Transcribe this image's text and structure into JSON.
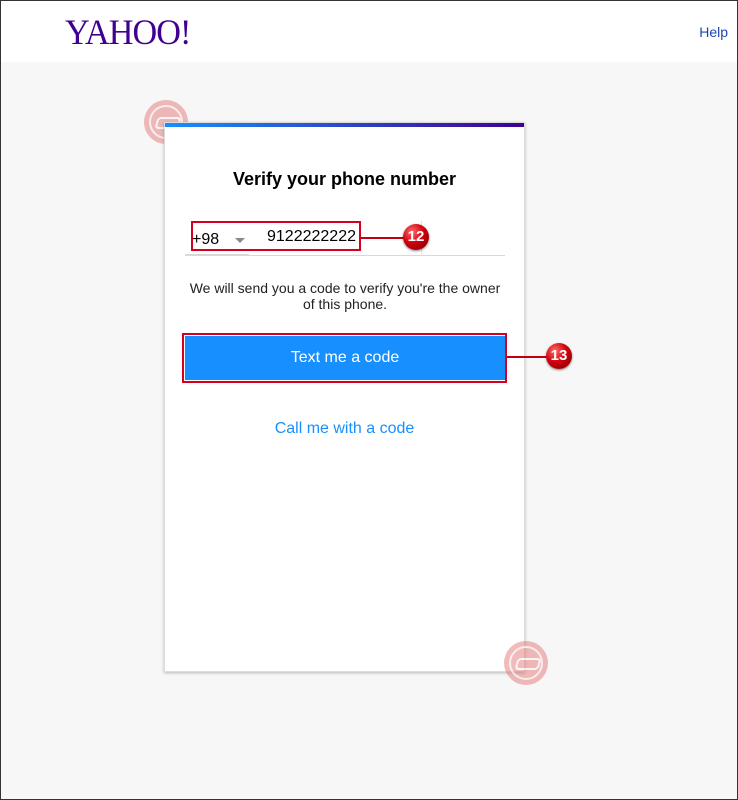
{
  "header": {
    "logo": "YAHOO!",
    "help_label": "Help"
  },
  "card": {
    "title": "Verify your phone number",
    "country_code": "+98",
    "phone_value": "9122222222",
    "info_text": "We will send you a code to verify you're the owner of this phone.",
    "text_code_label": "Text me a code",
    "call_code_label": "Call me with a code"
  },
  "annotations": {
    "badge_12": "12",
    "badge_13": "13"
  },
  "colors": {
    "brand_purple": "#400090",
    "primary_blue": "#188fff",
    "annotation_red": "#d5001f"
  }
}
